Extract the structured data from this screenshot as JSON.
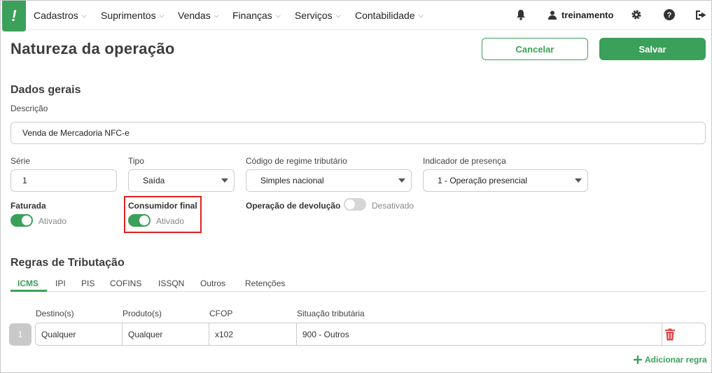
{
  "nav": {
    "logo": "!",
    "items": [
      {
        "label": "Cadastros"
      },
      {
        "label": "Suprimentos"
      },
      {
        "label": "Vendas"
      },
      {
        "label": "Finanças"
      },
      {
        "label": "Serviços"
      },
      {
        "label": "Contabilidade"
      }
    ],
    "user": "treinamento",
    "icons": [
      "bell-icon",
      "user-icon",
      "gear-icon",
      "help-icon",
      "logout-icon"
    ]
  },
  "page": {
    "title": "Natureza da operação",
    "cancel_label": "Cancelar",
    "save_label": "Salvar"
  },
  "general": {
    "section_title": "Dados gerais",
    "descricao_label": "Descrição",
    "descricao_value": "Venda de Mercadoria NFC-e",
    "serie_label": "Série",
    "serie_value": "1",
    "tipo_label": "Tipo",
    "tipo_value": "Saída",
    "regime_label": "Código de regime tributário",
    "regime_value": "Simples nacional",
    "presenca_label": "Indicador de presença",
    "presenca_value": "1 - Operação presencial",
    "faturada_label": "Faturada",
    "faturada_state": "Ativado",
    "faturada_on": true,
    "consumidor_label": "Consumidor final",
    "consumidor_state": "Ativado",
    "consumidor_on": true,
    "devolucao_label": "Operação de devolução",
    "devolucao_state": "Desativado",
    "devolucao_on": false
  },
  "rules": {
    "section_title": "Regras de Tributação",
    "tabs": [
      {
        "label": "ICMS",
        "active": true
      },
      {
        "label": "IPI"
      },
      {
        "label": "PIS"
      },
      {
        "label": "COFINS"
      },
      {
        "label": "ISSQN"
      },
      {
        "label": "Outros"
      },
      {
        "label": "Retenções"
      }
    ],
    "columns": [
      "Destino(s)",
      "Produto(s)",
      "CFOP",
      "Situação tributária"
    ],
    "rows": [
      {
        "index": "1",
        "destino": "Qualquer",
        "produto": "Qualquer",
        "cfop": "x102",
        "situacao": "900 - Outros"
      }
    ],
    "add_label": "Adicionar regra"
  },
  "colors": {
    "accent": "#3aa05a",
    "highlight": "#e02020",
    "delete": "#e04848"
  }
}
